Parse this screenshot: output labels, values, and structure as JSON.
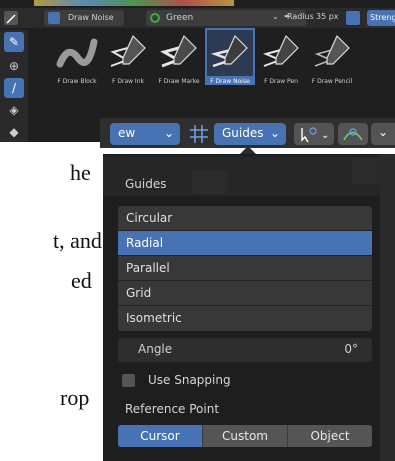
{
  "doc": {
    "lines": [
      "he",
      "t, and",
      "ed",
      "rop"
    ]
  },
  "brush_panel": {
    "header": {
      "brush_name": "Draw Noise",
      "material": "Green",
      "radius_label": "Radius",
      "radius_value": "35 px",
      "strength_label": "Streng"
    },
    "brushes": [
      {
        "label": "F Draw Block"
      },
      {
        "label": "F Draw Ink"
      },
      {
        "label": "F Draw Marke"
      },
      {
        "label": "F Draw Noise",
        "selected": true
      },
      {
        "label": "F Draw Pen"
      },
      {
        "label": "F Draw Pencil"
      }
    ]
  },
  "toolbar": {
    "view_label": "ew",
    "guides_label": "Guides"
  },
  "popover": {
    "title": "Guides",
    "types": [
      {
        "label": "Circular",
        "selected": false
      },
      {
        "label": "Radial",
        "selected": true
      },
      {
        "label": "Parallel",
        "selected": false
      },
      {
        "label": "Grid",
        "selected": false
      },
      {
        "label": "Isometric",
        "selected": false
      }
    ],
    "angle_label": "Angle",
    "angle_value": "0°",
    "use_snapping_label": "Use Snapping",
    "use_snapping_checked": false,
    "reference_point_label": "Reference Point",
    "reference_options": [
      {
        "label": "Cursor",
        "selected": true
      },
      {
        "label": "Custom",
        "selected": false
      },
      {
        "label": "Object",
        "selected": false
      }
    ]
  },
  "colors": {
    "accent": "#4772b3",
    "panel_bg": "#1e1e1e",
    "item_bg": "#383838"
  }
}
